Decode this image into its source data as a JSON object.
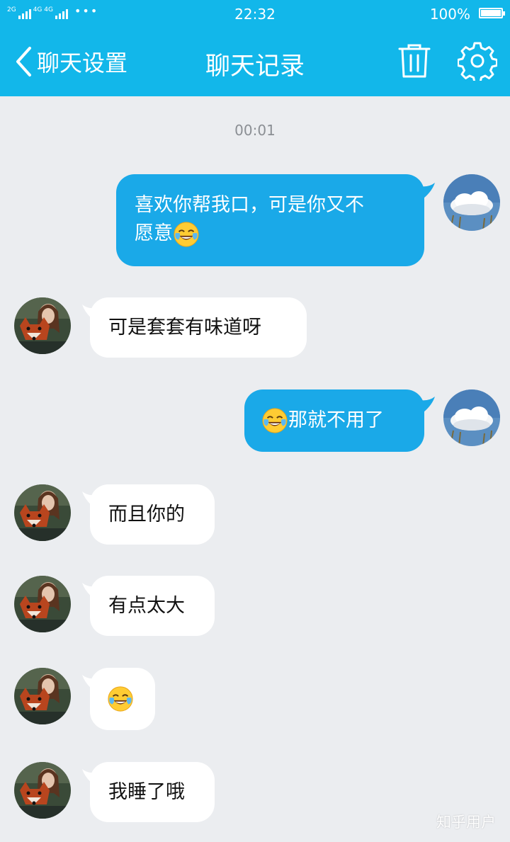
{
  "status_bar": {
    "network_left": "2G",
    "network_right": "4G 4G",
    "time": "22:32",
    "battery_text": "100%",
    "battery_level": 1.0
  },
  "header": {
    "back_label": "聊天设置",
    "title": "聊天记录",
    "icons": [
      "chevron-left-icon",
      "trash-icon",
      "gear-icon"
    ]
  },
  "chat": {
    "timestamp": "00:01",
    "messages": [
      {
        "side": "out",
        "text_line1": "喜欢你帮我口，可是你又不",
        "text_line2": "愿意",
        "emoji": "face-with-tears-of-joy"
      },
      {
        "side": "in",
        "text": "可是套套有味道呀"
      },
      {
        "side": "out",
        "text": "那就不用了",
        "emoji": "face-with-tears-of-joy"
      },
      {
        "side": "in",
        "text": "而且你的"
      },
      {
        "side": "in",
        "text": "有点太大"
      },
      {
        "side": "in",
        "emoji": "face-with-tears-of-joy"
      },
      {
        "side": "in",
        "text": "我睡了哦"
      }
    ]
  },
  "watermark": "知乎用户",
  "colors": {
    "accent": "#12b7ea",
    "outgoing_bubble": "#1aa9e8",
    "incoming_bubble": "#ffffff",
    "background": "#ebedf0"
  }
}
